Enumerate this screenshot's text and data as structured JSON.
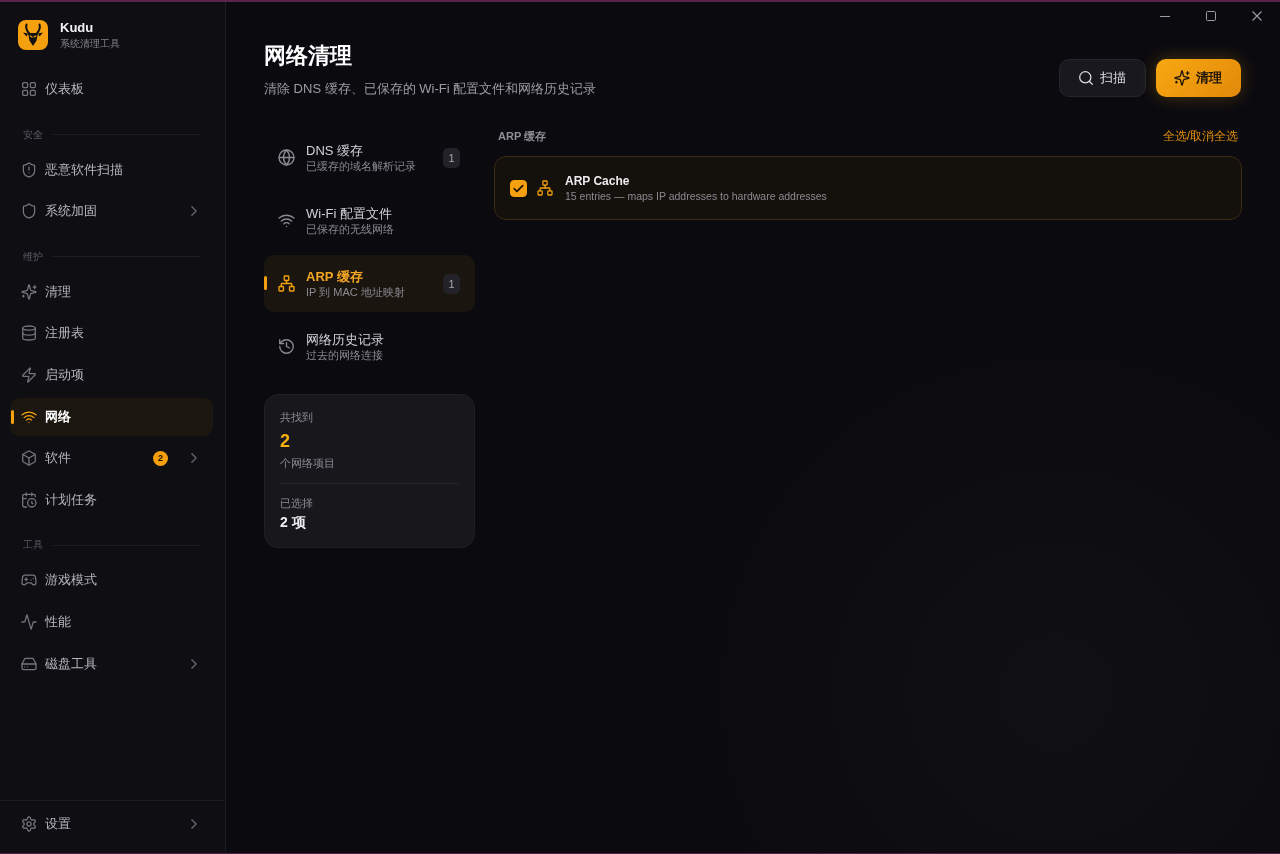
{
  "app": {
    "name": "Kudu",
    "tagline": "系统清理工具"
  },
  "sidebar": {
    "sections": [
      {
        "items": [
          {
            "label": "仪表板",
            "selected": false,
            "expandable": false
          }
        ]
      },
      {
        "title": "安全",
        "items": [
          {
            "label": "恶意软件扫描",
            "selected": false,
            "expandable": false
          },
          {
            "label": "系统加固",
            "selected": false,
            "expandable": true
          }
        ]
      },
      {
        "title": "维护",
        "items": [
          {
            "label": "清理",
            "selected": false,
            "expandable": false
          },
          {
            "label": "注册表",
            "selected": false,
            "expandable": false
          },
          {
            "label": "启动项",
            "selected": false,
            "expandable": false
          },
          {
            "label": "网络",
            "selected": true,
            "expandable": false
          },
          {
            "label": "软件",
            "selected": false,
            "expandable": true,
            "badge": "2"
          },
          {
            "label": "计划任务",
            "selected": false,
            "expandable": false
          }
        ]
      },
      {
        "title": "工具",
        "items": [
          {
            "label": "游戏模式",
            "selected": false,
            "expandable": false
          },
          {
            "label": "性能",
            "selected": false,
            "expandable": false
          },
          {
            "label": "磁盘工具",
            "selected": false,
            "expandable": true
          }
        ]
      }
    ],
    "footer": {
      "label": "设置",
      "selected": false,
      "expandable": true
    }
  },
  "page": {
    "title": "网络清理",
    "subtitle": "清除 DNS 缓存、已保存的 Wi-Fi 配置文件和网络历史记录"
  },
  "actions": [
    {
      "label": "扫描",
      "kind": "secondary"
    },
    {
      "label": "清理",
      "kind": "primary"
    }
  ],
  "categories": [
    {
      "title": "DNS 缓存",
      "subtitle": "已缓存的域名解析记录",
      "count": "1",
      "selected": false
    },
    {
      "title": "Wi-Fi 配置文件",
      "subtitle": "已保存的无线网络",
      "selected": false
    },
    {
      "title": "ARP 缓存",
      "subtitle": "IP 到 MAC 地址映射",
      "count": "1",
      "selected": true
    },
    {
      "title": "网络历史记录",
      "subtitle": "过去的网络连接",
      "selected": false
    }
  ],
  "summary": {
    "found_label": "共找到",
    "found_count": "2",
    "found_unit": "个网络项目",
    "selected_label": "已选择",
    "selected_count": "2 项"
  },
  "detail": {
    "title": "ARP 缓存",
    "select_all": "全选/取消全选",
    "items": [
      {
        "name": "ARP Cache",
        "description": "15 entries — maps IP addresses to hardware addresses",
        "checked": true
      }
    ]
  }
}
